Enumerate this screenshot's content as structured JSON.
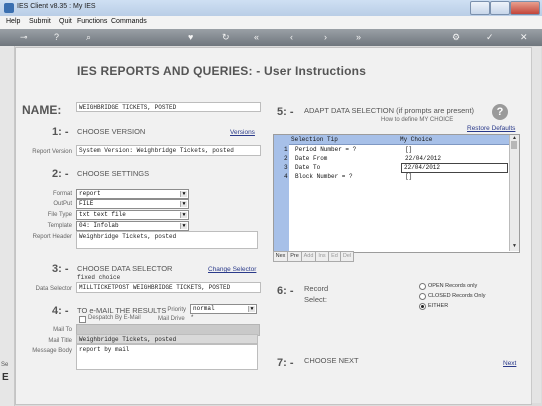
{
  "window": {
    "title": "IES Client v8.35 : My IES"
  },
  "menu": [
    "Help",
    "Submit",
    "Quit",
    "Functions",
    "Commands"
  ],
  "toolbar_icons": [
    "key-icon",
    "help-icon",
    "search-icon",
    "heart-icon",
    "refresh-icon",
    "back-icon",
    "prev-icon",
    "next-icon",
    "forward-icon",
    "settings-icon",
    "ok-icon",
    "close-icon"
  ],
  "page": {
    "title": "IES REPORTS AND QUERIES: -   User Instructions"
  },
  "name": {
    "label": "NAME:",
    "value": "WEIGHBRIDGE TICKETS, POSTED"
  },
  "step1": {
    "num": "1: -",
    "title": "CHOOSE VERSION",
    "link": "Versions",
    "field_label": "Report Version",
    "value": "System Version: Weighbridge Tickets, posted"
  },
  "step2": {
    "num": "2: -",
    "title": "CHOOSE SETTINGS",
    "format_label": "Format",
    "format": "report",
    "output_label": "OutPut",
    "output": "FILE",
    "filetype_label": "File Type",
    "filetype": "txt text file",
    "template_label": "Template",
    "template": "04: Infolab",
    "header_label": "Report Header",
    "header": "Weighbridge Tickets, posted"
  },
  "step3": {
    "num": "3: -",
    "title": "CHOOSE DATA SELECTOR",
    "link": "Change Selector",
    "sub": "fixed choice",
    "field_label": "Data Selector",
    "value": "MILLTICKETPOST WEIGHBRIDGE TICKETS, POSTED"
  },
  "step4": {
    "num": "4: -",
    "title": "TO e-MAIL THE RESULTS",
    "priority_label": "Priority",
    "priority": "normal",
    "despatch_label": "Despatch By E-Mail",
    "drive_label": "Mail Drive",
    "drive_value": "*",
    "mailto_label": "Mail To",
    "mailtitle_label": "Mail Title",
    "mailtitle": "Weighbridge Tickets, posted",
    "mailbody_label": "Message Body",
    "mailbody": "report by mail"
  },
  "step5": {
    "num": "5: -",
    "title": "ADAPT DATA SELECTION (if prompts are present)",
    "howto": "How to define MY CHOICE",
    "restore": "Restore Defaults",
    "col_tip": "Selection Tip",
    "col_choice": "My Choice",
    "rows": [
      {
        "n": "1",
        "tip": "Period Number = ?",
        "choice": "[]"
      },
      {
        "n": "2",
        "tip": "Date From",
        "choice": "22/04/2012"
      },
      {
        "n": "3",
        "tip": "Date To",
        "choice": "22/04/2012"
      },
      {
        "n": "4",
        "tip": "Block Number = ?",
        "choice": "[]"
      }
    ],
    "tabs": [
      "Nex",
      "Pre",
      "Add",
      "Ins",
      "Ed",
      "Del"
    ]
  },
  "step6": {
    "num": "6: -",
    "title": "Record",
    "sub": "Select:",
    "options": [
      "OPEN Records only",
      "CLOSED Records Only",
      "EITHER"
    ],
    "selected": "EITHER"
  },
  "step7": {
    "num": "7: -",
    "title": "CHOOSE NEXT",
    "link": "Next"
  },
  "left_strip": {
    "top": "Se",
    "bottom": "E"
  }
}
